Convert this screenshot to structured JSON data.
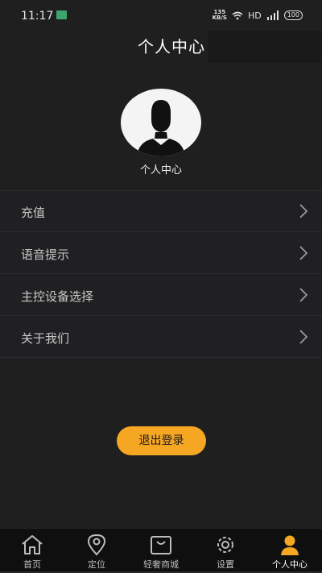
{
  "status_bar": {
    "time": "11:17",
    "net_speed_value": "135",
    "net_speed_unit": "KB/S",
    "hd": "HD",
    "battery": "100"
  },
  "header": {
    "title": "个人中心"
  },
  "profile": {
    "caption": "个人中心"
  },
  "menu": {
    "items": [
      {
        "label": "充值"
      },
      {
        "label": "语音提示"
      },
      {
        "label": "主控设备选择"
      },
      {
        "label": "关于我们"
      }
    ]
  },
  "logout": {
    "label": "退出登录"
  },
  "tabs": [
    {
      "label": "首页",
      "icon": "home-icon"
    },
    {
      "label": "定位",
      "icon": "location-pin-icon"
    },
    {
      "label": "轻奢商城",
      "icon": "shopping-bag-icon"
    },
    {
      "label": "设置",
      "icon": "gear-icon"
    },
    {
      "label": "个人中心",
      "icon": "user-icon",
      "active": true
    }
  ],
  "colors": {
    "accent": "#f5a623",
    "background": "#1f1f20",
    "tab_bar": "#0f0f10"
  }
}
